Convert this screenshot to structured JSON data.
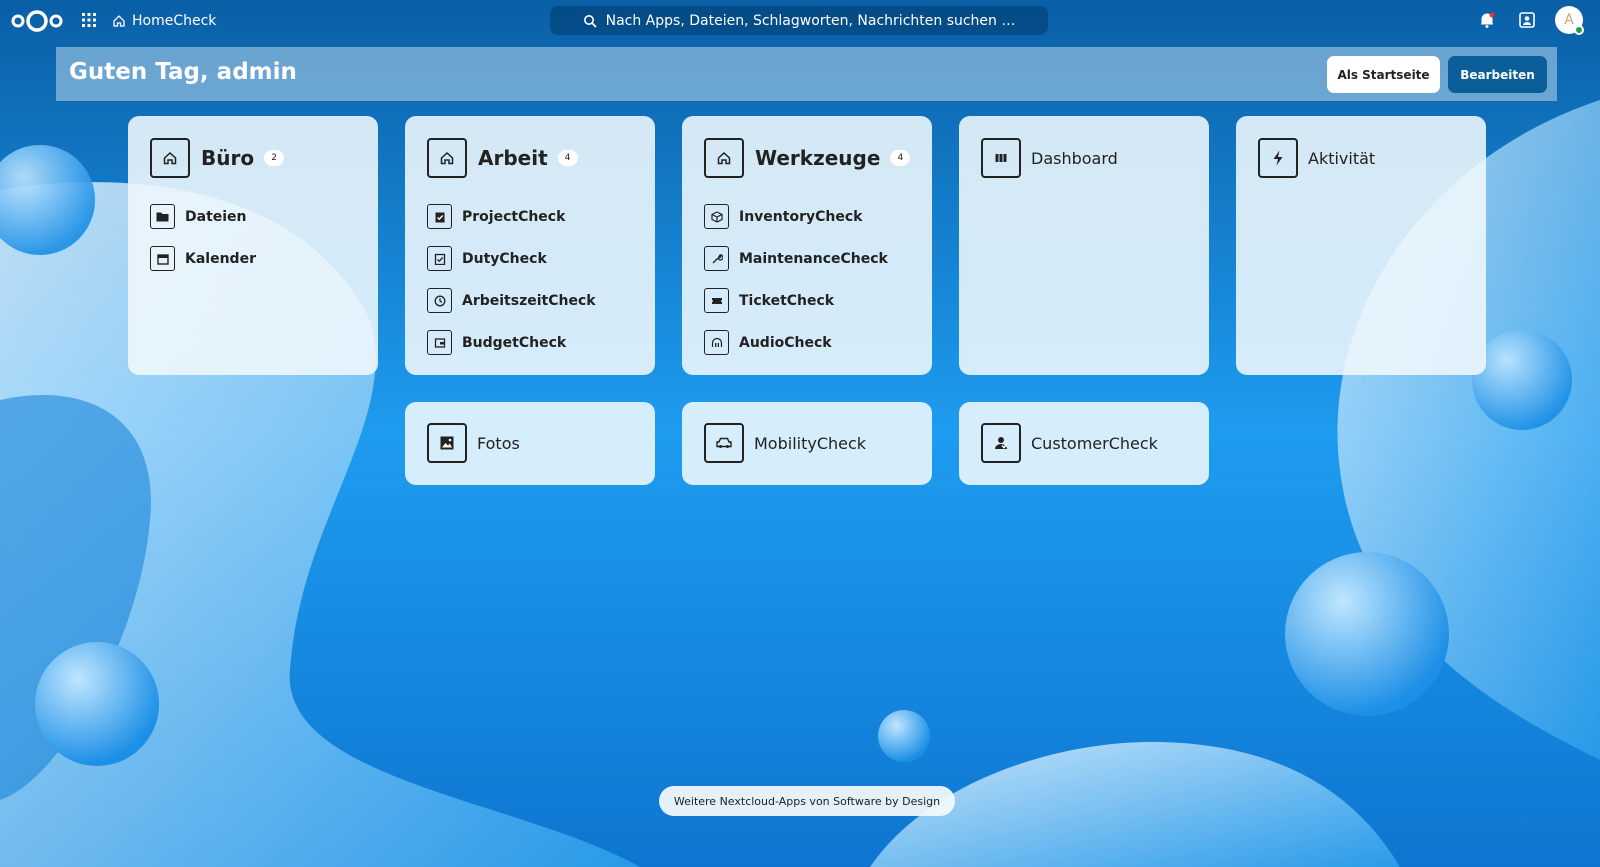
{
  "topbar": {
    "app_name": "HomeCheck",
    "search_placeholder": "Nach Apps, Dateien, Schlagworten, Nachrichten suchen …",
    "avatar_initial": "A"
  },
  "header": {
    "greeting": "Guten Tag, admin",
    "home_button": "Als Startseite",
    "edit_button": "Bearbeiten"
  },
  "groups": [
    {
      "title": "Büro",
      "count": "2",
      "items": [
        "Dateien",
        "Kalender"
      ]
    },
    {
      "title": "Arbeit",
      "count": "4",
      "items": [
        "ProjectCheck",
        "DutyCheck",
        "ArbeitszeitCheck",
        "BudgetCheck"
      ]
    },
    {
      "title": "Werkzeuge",
      "count": "4",
      "items": [
        "InventoryCheck",
        "MaintenanceCheck",
        "TicketCheck",
        "AudioCheck"
      ]
    }
  ],
  "tiles": {
    "dashboard": "Dashboard",
    "aktivitaet": "Aktivität",
    "fotos": "Fotos",
    "mobility": "MobilityCheck",
    "customer": "CustomerCheck"
  },
  "footer": {
    "text": "Weitere Nextcloud-Apps von Software by Design"
  },
  "colors": {
    "accent": "#0b5e97",
    "background": "#1a8ee8"
  }
}
